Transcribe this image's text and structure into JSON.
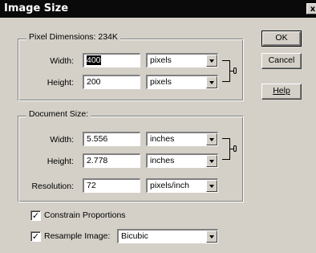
{
  "window": {
    "title": "Image Size",
    "close_glyph": "x"
  },
  "pixel_dimensions": {
    "label_text": "Pixel Dimensions:",
    "size": "234K",
    "width_label": "Width:",
    "width_value": "400",
    "width_unit": "pixels",
    "height_label": "Height:",
    "height_value": "200",
    "height_unit": "pixels"
  },
  "document_size": {
    "label": "Document Size:",
    "width_label": "Width:",
    "width_value": "5.556",
    "width_unit": "inches",
    "height_label": "Height:",
    "height_value": "2.778",
    "height_unit": "inches",
    "resolution_label": "Resolution:",
    "resolution_value": "72",
    "resolution_unit": "pixels/inch"
  },
  "options": {
    "constrain_label": "Constrain Proportions",
    "constrain_checked": true,
    "resample_label": "Resample Image:",
    "resample_checked": true,
    "resample_method": "Bicubic"
  },
  "buttons": {
    "ok": "OK",
    "cancel": "Cancel",
    "help": "Help"
  },
  "icons": {
    "link": "chain-link-icon",
    "close": "close-icon",
    "dropdown": "chevron-down-icon",
    "check": "check-icon"
  }
}
